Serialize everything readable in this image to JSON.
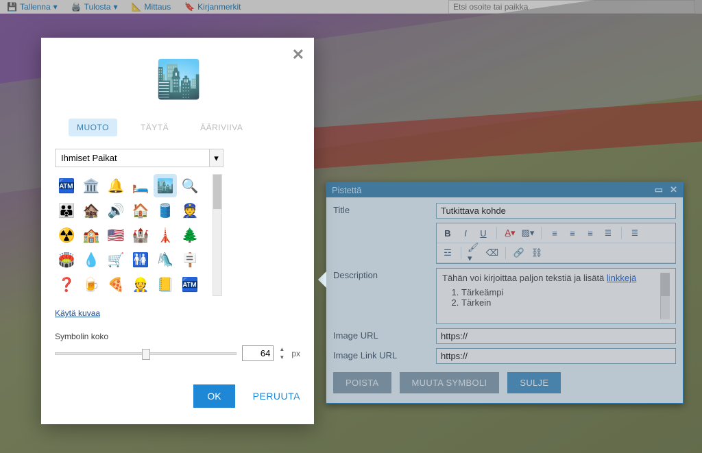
{
  "toolbar": {
    "save": "Tallenna",
    "print": "Tulosta",
    "measure": "Mittaus",
    "bookmarks": "Kirjanmerkit",
    "search_placeholder": "Etsi osoite tai paikka"
  },
  "symbolDialog": {
    "tabs": {
      "shape": "MUOTO",
      "fill": "TÄYTÄ",
      "outline": "ÄÄRIVIIVA"
    },
    "category": "Ihmiset Paikat",
    "useImage": "Käytä kuvaa",
    "sizeLabel": "Symbolin koko",
    "sizeValue": "64",
    "sizeUnit": "px",
    "ok": "OK",
    "cancel": "PERUUTA",
    "icons": [
      {
        "name": "atm-icon",
        "glyph": "🏧"
      },
      {
        "name": "bank-icon",
        "glyph": "🏛️"
      },
      {
        "name": "bell-icon",
        "glyph": "🔔"
      },
      {
        "name": "bed-icon",
        "glyph": "🛏️"
      },
      {
        "name": "city-icon",
        "glyph": "🏙️",
        "selected": true
      },
      {
        "name": "search-icon",
        "glyph": "🔍"
      },
      {
        "name": "family-icon",
        "glyph": "👪"
      },
      {
        "name": "hut-icon",
        "glyph": "🏚️"
      },
      {
        "name": "speaker-icon",
        "glyph": "🔊"
      },
      {
        "name": "house-icon",
        "glyph": "🏠"
      },
      {
        "name": "barrel-icon",
        "glyph": "🛢️"
      },
      {
        "name": "police-icon",
        "glyph": "👮"
      },
      {
        "name": "radiation-icon",
        "glyph": "☢️"
      },
      {
        "name": "school-icon",
        "glyph": "🏫"
      },
      {
        "name": "flag-us-icon",
        "glyph": "🇺🇸"
      },
      {
        "name": "castle-icon",
        "glyph": "🏰"
      },
      {
        "name": "tower-icon",
        "glyph": "🗼"
      },
      {
        "name": "trees-icon",
        "glyph": "🌲"
      },
      {
        "name": "stadium-icon",
        "glyph": "🏟️"
      },
      {
        "name": "drop-icon",
        "glyph": "💧"
      },
      {
        "name": "cart-icon",
        "glyph": "🛒"
      },
      {
        "name": "restroom-icon",
        "glyph": "🚻"
      },
      {
        "name": "playground-icon",
        "glyph": "🛝"
      },
      {
        "name": "sign-icon",
        "glyph": "🪧"
      },
      {
        "name": "question-icon",
        "glyph": "❓"
      },
      {
        "name": "beer-icon",
        "glyph": "🍺"
      },
      {
        "name": "pizza-icon",
        "glyph": "🍕"
      },
      {
        "name": "worker-icon",
        "glyph": "👷"
      },
      {
        "name": "note-icon",
        "glyph": "📒"
      },
      {
        "name": "atm2-icon",
        "glyph": "🏧"
      }
    ]
  },
  "pointPanel": {
    "title": "Pistettä",
    "fields": {
      "titleLabel": "Title",
      "titleValue": "Tutkittava kohde",
      "descLabel": "Description",
      "descText": "Tähän voi kirjoittaa paljon tekstiä ja lisätä ",
      "descLink": "linkkejä",
      "descList": [
        "Tärkeämpi",
        "Tärkein"
      ],
      "imageUrlLabel": "Image URL",
      "imageUrlValue": "https://",
      "imageLinkLabel": "Image Link URL",
      "imageLinkValue": "https://"
    },
    "buttons": {
      "delete": "POISTA",
      "changeSymbol": "MUUTA SYMBOLI",
      "close": "SULJE"
    }
  }
}
